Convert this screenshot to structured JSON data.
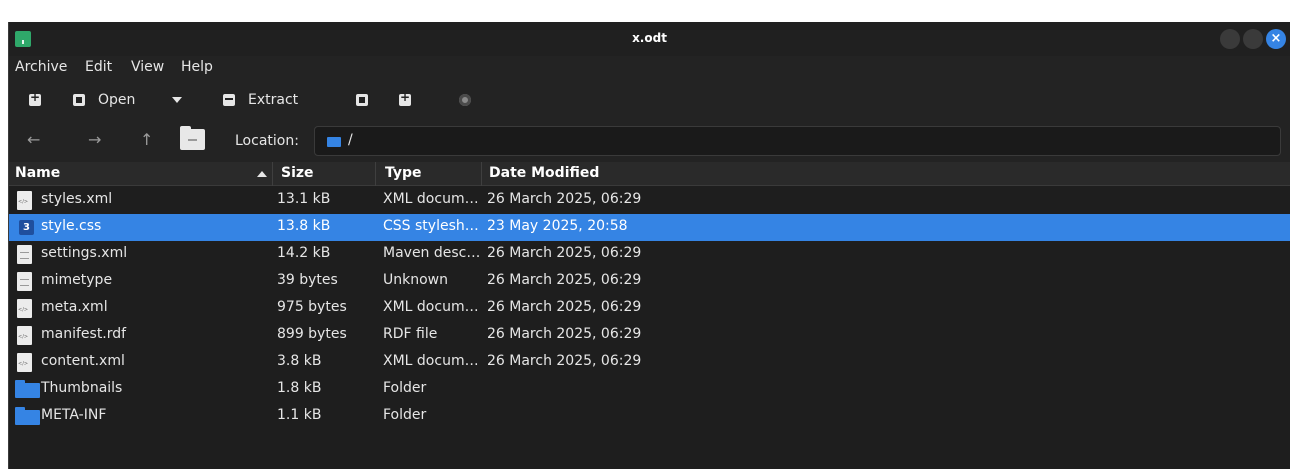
{
  "window": {
    "title": "x.odt",
    "close_glyph": "×"
  },
  "menu": [
    "Archive",
    "Edit",
    "View",
    "Help"
  ],
  "toolbar": {
    "new_icon": "new-archive-icon",
    "open_label": "Open",
    "extract_label": "Extract",
    "add_files_icon": "add-files-icon",
    "add_folder_icon": "add-folder-icon",
    "stop_icon": "stop-icon"
  },
  "location": {
    "back": "←",
    "forward": "→",
    "up": "↑",
    "label": "Location:",
    "value": "/"
  },
  "columns": {
    "name": "Name",
    "size": "Size",
    "type": "Type",
    "date": "Date Modified"
  },
  "files": [
    {
      "name": "styles.xml",
      "size": "13.1 kB",
      "type": "XML docum…",
      "date": "26 March 2025, 06:29",
      "icon": "xml-file-icon"
    },
    {
      "name": "style.css",
      "size": "13.8 kB",
      "type": "CSS stylesh…",
      "date": "23 May 2025, 20:58",
      "icon": "css-file-icon",
      "css_glyph": "3"
    },
    {
      "name": "settings.xml",
      "size": "14.2 kB",
      "type": "Maven desc…",
      "date": "26 March 2025, 06:29",
      "icon": "text-file-icon"
    },
    {
      "name": "mimetype",
      "size": "39 bytes",
      "type": "Unknown",
      "date": "26 March 2025, 06:29",
      "icon": "text-file-icon"
    },
    {
      "name": "meta.xml",
      "size": "975 bytes",
      "type": "XML docum…",
      "date": "26 March 2025, 06:29",
      "icon": "xml-file-icon"
    },
    {
      "name": "manifest.rdf",
      "size": "899 bytes",
      "type": "RDF file",
      "date": "26 March 2025, 06:29",
      "icon": "xml-file-icon"
    },
    {
      "name": "content.xml",
      "size": "3.8 kB",
      "type": "XML docum…",
      "date": "26 March 2025, 06:29",
      "icon": "xml-file-icon"
    },
    {
      "name": "Thumbnails",
      "size": "1.8 kB",
      "type": "Folder",
      "date": "",
      "icon": "folder-icon"
    },
    {
      "name": "META-INF",
      "size": "1.1 kB",
      "type": "Folder",
      "date": "",
      "icon": "folder-icon"
    }
  ],
  "colors": {
    "selection": "#3584e4",
    "background": "#1e1e1e",
    "bar": "#232323"
  }
}
